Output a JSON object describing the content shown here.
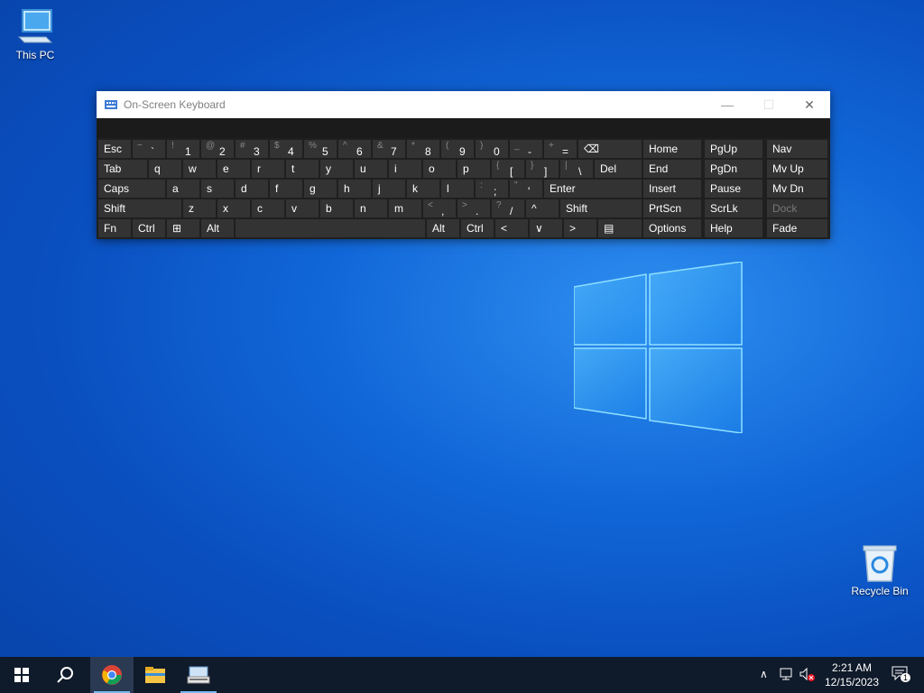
{
  "desktop": {
    "icons": [
      {
        "label": "This PC"
      },
      {
        "label": "Recycle Bin"
      }
    ]
  },
  "osk": {
    "title": "On-Screen Keyboard",
    "controls": {
      "minimize": "—",
      "maximize": "☐",
      "close": "✕"
    },
    "row1": [
      {
        "main": "Esc"
      },
      {
        "shift": "~",
        "main": "`"
      },
      {
        "shift": "!",
        "main": "1"
      },
      {
        "shift": "@",
        "main": "2"
      },
      {
        "shift": "#",
        "main": "3"
      },
      {
        "shift": "$",
        "main": "4"
      },
      {
        "shift": "%",
        "main": "5"
      },
      {
        "shift": "^",
        "main": "6"
      },
      {
        "shift": "&",
        "main": "7"
      },
      {
        "shift": "*",
        "main": "8"
      },
      {
        "shift": "(",
        "main": "9"
      },
      {
        "shift": ")",
        "main": "0"
      },
      {
        "shift": "_",
        "main": "-"
      },
      {
        "shift": "+",
        "main": "="
      },
      {
        "main": "⌫"
      }
    ],
    "row2": [
      {
        "main": "Tab"
      },
      {
        "main": "q"
      },
      {
        "main": "w"
      },
      {
        "main": "e"
      },
      {
        "main": "r"
      },
      {
        "main": "t"
      },
      {
        "main": "y"
      },
      {
        "main": "u"
      },
      {
        "main": "i"
      },
      {
        "main": "o"
      },
      {
        "main": "p"
      },
      {
        "shift": "{",
        "main": "["
      },
      {
        "shift": "}",
        "main": "]"
      },
      {
        "shift": "|",
        "main": "\\"
      },
      {
        "main": "Del"
      }
    ],
    "row3": [
      {
        "main": "Caps"
      },
      {
        "main": "a"
      },
      {
        "main": "s"
      },
      {
        "main": "d"
      },
      {
        "main": "f"
      },
      {
        "main": "g"
      },
      {
        "main": "h"
      },
      {
        "main": "j"
      },
      {
        "main": "k"
      },
      {
        "main": "l"
      },
      {
        "shift": ":",
        "main": ";"
      },
      {
        "shift": "\"",
        "main": "'"
      },
      {
        "main": "Enter"
      }
    ],
    "row4": [
      {
        "main": "Shift"
      },
      {
        "main": "z"
      },
      {
        "main": "x"
      },
      {
        "main": "c"
      },
      {
        "main": "v"
      },
      {
        "main": "b"
      },
      {
        "main": "n"
      },
      {
        "main": "m"
      },
      {
        "shift": "<",
        "main": ","
      },
      {
        "shift": ">",
        "main": "."
      },
      {
        "shift": "?",
        "main": "/"
      },
      {
        "main": "^"
      },
      {
        "main": "Shift"
      }
    ],
    "row5": [
      {
        "main": "Fn"
      },
      {
        "main": "Ctrl"
      },
      {
        "main": "⊞"
      },
      {
        "main": "Alt"
      },
      {
        "main": ""
      },
      {
        "main": "Alt"
      },
      {
        "main": "Ctrl"
      },
      {
        "main": "<"
      },
      {
        "main": "∨"
      },
      {
        "main": ">"
      },
      {
        "main": "▤"
      }
    ],
    "nav": [
      [
        "Home",
        "PgUp",
        "Nav"
      ],
      [
        "End",
        "PgDn",
        "Mv Up"
      ],
      [
        "Insert",
        "Pause",
        "Mv Dn"
      ],
      [
        "PrtScn",
        "ScrLk",
        "Dock"
      ],
      [
        "Options",
        "Help",
        "Fade"
      ]
    ]
  },
  "taskbar": {
    "apps": [
      "start-icon",
      "search-icon",
      "chrome-icon",
      "file-explorer-icon",
      "on-screen-keyboard-icon"
    ],
    "clock_time": "2:21 AM",
    "clock_date": "12/15/2023",
    "notification_count": "1"
  },
  "colors": {
    "accent": "#76b9ed",
    "key": "#333333",
    "taskbar": "#0f1a2a"
  }
}
